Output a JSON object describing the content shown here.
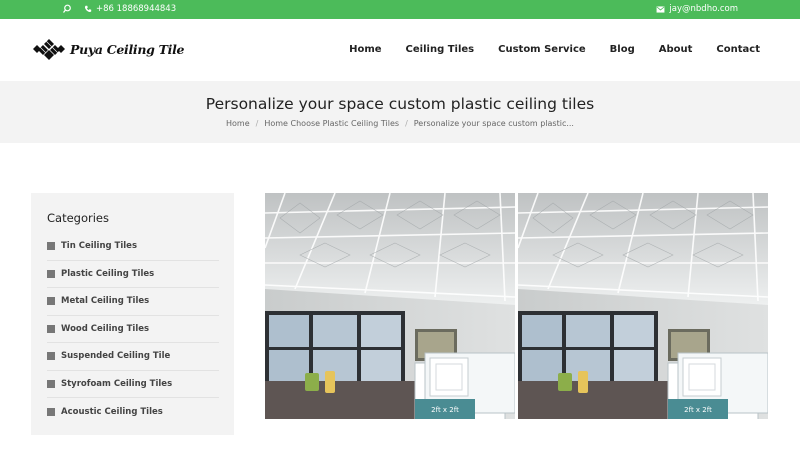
{
  "topbar": {
    "phone": "+86 18868944843",
    "email": "jay@nbdho.com",
    "bg_color": "#4cbb5a",
    "icons": [
      "search-icon",
      "phone-icon",
      "mail-icon"
    ]
  },
  "header": {
    "logo_text": "Puya Ceiling Tile",
    "nav": [
      "Home",
      "Ceiling Tiles",
      "Custom Service",
      "Blog",
      "About",
      "Contact"
    ]
  },
  "page": {
    "title": "Personalize your space custom plastic ceiling tiles",
    "breadcrumb": [
      "Home",
      "Home Choose Plastic Ceiling Tiles",
      "Personalize your space custom plastic..."
    ]
  },
  "sidebar": {
    "title": "Categories",
    "items": [
      "Tin Ceiling Tiles",
      "Plastic Ceiling Tiles",
      "Metal Ceiling Tiles",
      "Wood Ceiling Tiles",
      "Suspended Ceiling Tile",
      "Styrofoam Ceiling Tiles",
      "Acoustic Ceiling Tiles"
    ]
  },
  "products": {
    "pack_label": "2ft x 2ft"
  }
}
